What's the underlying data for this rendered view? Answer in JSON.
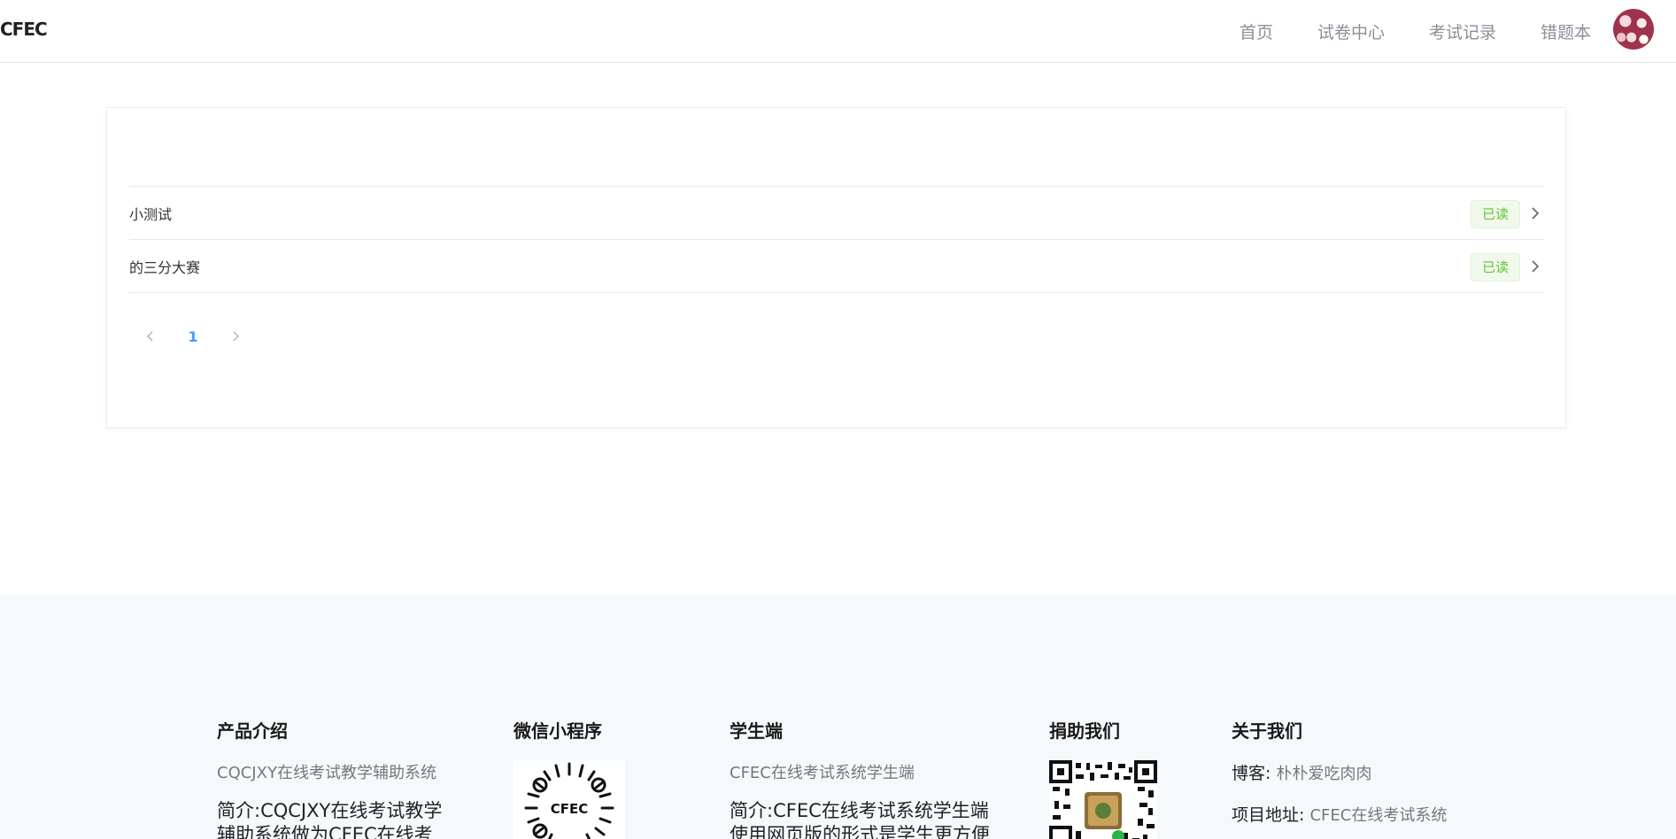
{
  "header": {
    "logo_text": "CFEC",
    "nav": [
      "首页",
      "试卷中心",
      "考试记录",
      "错题本"
    ]
  },
  "list": {
    "items": [
      {
        "title": "小测试",
        "status": "已读"
      },
      {
        "title": "的三分大赛",
        "status": "已读"
      }
    ]
  },
  "pagination": {
    "current": "1"
  },
  "footer": {
    "product": {
      "title": "产品介绍",
      "subtitle": "CQCJXY在线考试教学辅助系统",
      "desc": "简介:CQCJXY在线考试教学辅助系统做为CFEC在线考试"
    },
    "miniapp": {
      "title": "微信小程序",
      "qr_label": "CFEC"
    },
    "student": {
      "title": "学生端",
      "subtitle": "CFEC在线考试系统学生端",
      "desc": "简介:CFEC在线考试系统学生端使用网页版的形式是学生更方便"
    },
    "donate": {
      "title": "捐助我们"
    },
    "about": {
      "title": "关于我们",
      "blog_label": "博客:",
      "blog_value": "朴朴爱吃肉肉",
      "project_label": "项目地址:",
      "project_value": "CFEC在线考试系统"
    }
  },
  "colors": {
    "accent": "#409eff",
    "read_badge": "#67c23a",
    "footer_bg": "#f6f9fc"
  }
}
